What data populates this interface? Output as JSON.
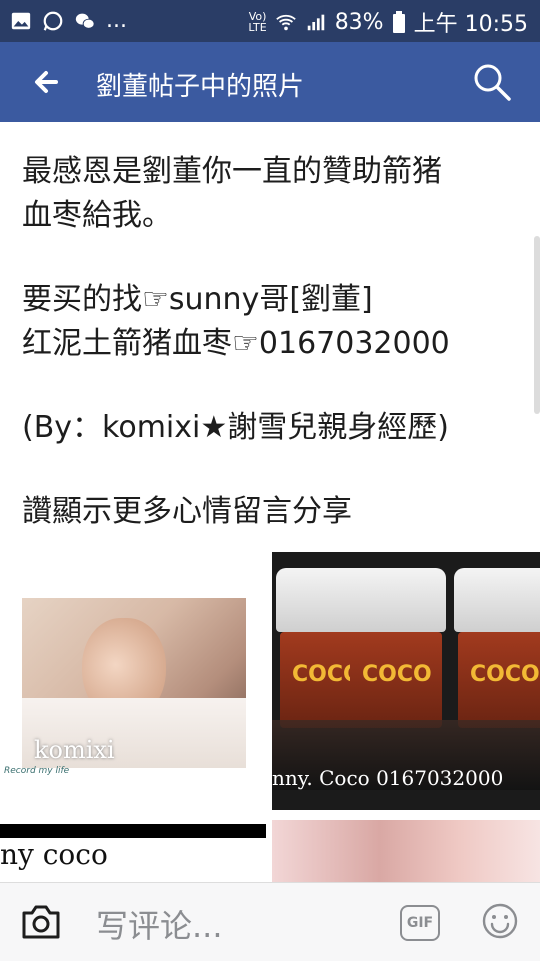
{
  "status_bar": {
    "notif_more": "...",
    "network": "VoLTE",
    "battery": "83%",
    "time": "上午 10:55",
    "icons": [
      "gallery-icon",
      "whatsapp-icon",
      "wechat-icon",
      "volte-icon",
      "wifi-icon",
      "signal-icon",
      "battery-icon"
    ]
  },
  "header": {
    "title": "劉董帖子中的照片",
    "back_icon": "arrow-left-icon",
    "search_icon": "search-icon"
  },
  "post": {
    "line1": "最感恩是劉董你一直的贊助箭猪",
    "line2": "血枣給我。",
    "line3": "要买的找☞sunny哥[劉董]",
    "line4": "红泥土箭猪血枣☞0167032000",
    "line5": "(By：komixi★謝雪兒親身經歷)",
    "line6": "讚顯示更多心情留言分享"
  },
  "photos": {
    "photo1_watermark": "komixi",
    "photo1_signature": "Record my life",
    "photo2_jar_label": "COCO",
    "photo2_caption": "nny. Coco 0167032000",
    "photo3_caption": "ny coco"
  },
  "composer": {
    "placeholder": "写评论...",
    "gif_label": "GIF"
  },
  "colors": {
    "status_bar": "#2a3d66",
    "app_bar": "#3b5aa0",
    "text": "#1d1d1d",
    "composer_bg": "#f7f7f8"
  }
}
